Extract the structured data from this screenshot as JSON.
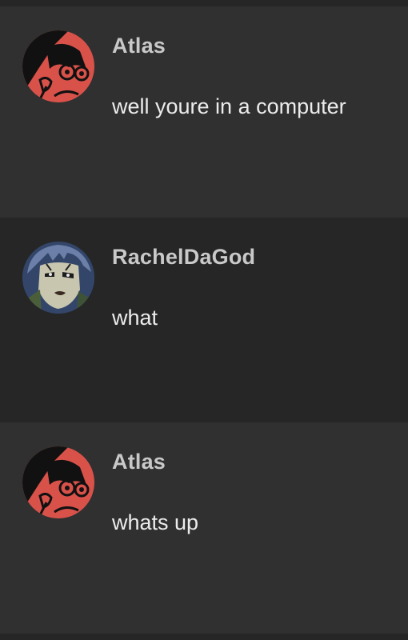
{
  "messages": [
    {
      "username": "Atlas",
      "text": "well youre in a computer",
      "avatar_icon": "atlas-avatar-icon"
    },
    {
      "username": "RachelDaGod",
      "text": "what",
      "avatar_icon": "racheldagod-avatar-icon"
    },
    {
      "username": "Atlas",
      "text": "whats up",
      "avatar_icon": "atlas-avatar-icon"
    }
  ],
  "colors": {
    "row_light": "#303030",
    "row_dark": "#262626",
    "username": "#c9c9c9",
    "message_text": "#ececec",
    "atlas_avatar_red": "#d9524a"
  }
}
